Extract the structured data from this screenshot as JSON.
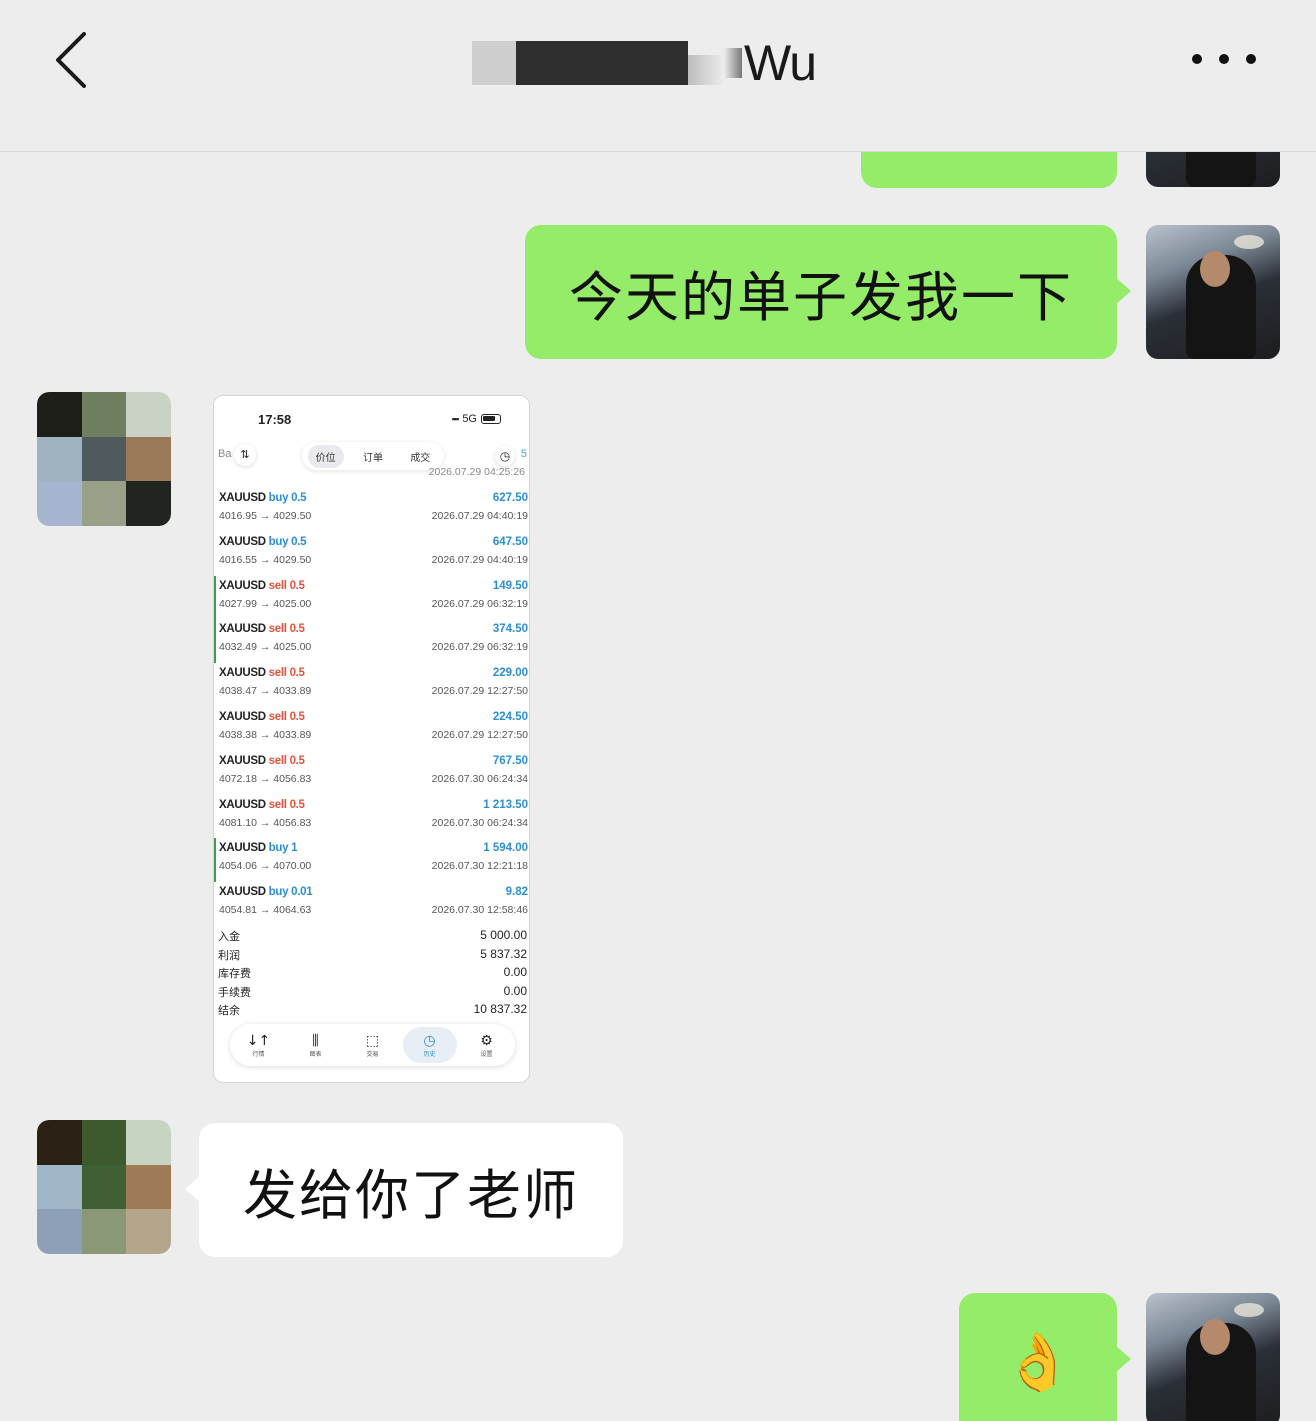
{
  "header": {
    "title": "Wu"
  },
  "messages": {
    "m1": "今天的单子发我一下",
    "m2": "发给你了老师",
    "m3": "👌"
  },
  "screenshot": {
    "status_time": "17:58",
    "status_net": "5G",
    "toolbar_left": "Ba",
    "toolbar_right": "5",
    "tabs": [
      "价位",
      "订单",
      "成交"
    ],
    "partial_time": "2026.07.29 04:25:26",
    "trades": [
      {
        "symbol": "XAUUSD",
        "side": "buy",
        "lot": "0.5",
        "profit": "627.50",
        "prices": "4016.95 → 4029.50",
        "time": "2026.07.29 04:40:19",
        "mark": false
      },
      {
        "symbol": "XAUUSD",
        "side": "buy",
        "lot": "0.5",
        "profit": "647.50",
        "prices": "4016.55 → 4029.50",
        "time": "2026.07.29 04:40:19",
        "mark": false
      },
      {
        "symbol": "XAUUSD",
        "side": "sell",
        "lot": "0.5",
        "profit": "149.50",
        "prices": "4027.99 → 4025.00",
        "time": "2026.07.29 06:32:19",
        "mark": true
      },
      {
        "symbol": "XAUUSD",
        "side": "sell",
        "lot": "0.5",
        "profit": "374.50",
        "prices": "4032.49 → 4025.00",
        "time": "2026.07.29 06:32:19",
        "mark": true
      },
      {
        "symbol": "XAUUSD",
        "side": "sell",
        "lot": "0.5",
        "profit": "229.00",
        "prices": "4038.47 → 4033.89",
        "time": "2026.07.29 12:27:50",
        "mark": false
      },
      {
        "symbol": "XAUUSD",
        "side": "sell",
        "lot": "0.5",
        "profit": "224.50",
        "prices": "4038.38 → 4033.89",
        "time": "2026.07.29 12:27:50",
        "mark": false
      },
      {
        "symbol": "XAUUSD",
        "side": "sell",
        "lot": "0.5",
        "profit": "767.50",
        "prices": "4072.18 → 4056.83",
        "time": "2026.07.30 06:24:34",
        "mark": false
      },
      {
        "symbol": "XAUUSD",
        "side": "sell",
        "lot": "0.5",
        "profit": "1 213.50",
        "prices": "4081.10 → 4056.83",
        "time": "2026.07.30 06:24:34",
        "mark": false
      },
      {
        "symbol": "XAUUSD",
        "side": "buy",
        "lot": "1",
        "profit": "1 594.00",
        "prices": "4054.06 → 4070.00",
        "time": "2026.07.30 12:21:18",
        "mark": true
      },
      {
        "symbol": "XAUUSD",
        "side": "buy",
        "lot": "0.01",
        "profit": "9.82",
        "prices": "4054.81 → 4064.63",
        "time": "2026.07.30 12:58:46",
        "mark": false
      }
    ],
    "summary": [
      {
        "label": "入金",
        "value": "5 000.00"
      },
      {
        "label": "利润",
        "value": "5 837.32"
      },
      {
        "label": "库存费",
        "value": "0.00"
      },
      {
        "label": "手续费",
        "value": "0.00"
      },
      {
        "label": "结余",
        "value": "10 837.32"
      }
    ],
    "nav": [
      {
        "icon": "↓↑",
        "label": "行情",
        "active": false
      },
      {
        "icon": "⫼",
        "label": "图表",
        "active": false
      },
      {
        "icon": "⬚",
        "label": "交易",
        "active": false
      },
      {
        "icon": "◷",
        "label": "历史",
        "active": true
      },
      {
        "icon": "⚙",
        "label": "设置",
        "active": false
      }
    ]
  },
  "colors": {
    "bubble_green": "#95ec69",
    "bubble_white": "#ffffff",
    "background": "#ededed",
    "buy_blue": "#2b8fd1",
    "sell_red": "#e0533d"
  },
  "icons": {
    "back": "chevron-left-icon",
    "more": "more-dots-icon"
  }
}
